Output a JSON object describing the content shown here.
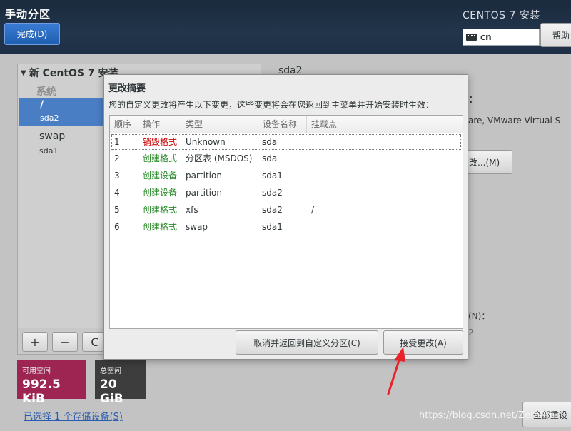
{
  "header": {
    "title": "手动分区",
    "done_button": "完成(D)",
    "product": "CENTOS 7 安装",
    "keyboard_layout": "cn",
    "help_button": "帮助"
  },
  "left_panel": {
    "install_title": "新 CentOS 7 安装",
    "system_label": "系统",
    "partitions": [
      {
        "mount": "/",
        "device": "sda2",
        "selected": true
      },
      {
        "mount": "swap",
        "device": "sda1",
        "selected": false
      }
    ],
    "tools": {
      "add": "+",
      "remove": "−",
      "refresh": "C"
    },
    "available_space": {
      "label": "可用空间",
      "value": "992.5 KiB"
    },
    "total_space": {
      "label": "总空间",
      "value": "20 GiB"
    },
    "storage_link": "已选择 1 个存储设备(S)"
  },
  "right_panel": {
    "title": "sda2",
    "colon_label": "：",
    "device_info": "are, VMware Virtual S",
    "modify_button": "改...(M)",
    "name_label": "(N)：",
    "name_value": "2",
    "reset_button": "全部重设"
  },
  "dialog": {
    "title": "更改摘要",
    "description": "您的自定义更改将产生以下变更，这些变更将会在您返回到主菜单并开始安装时生效：",
    "columns": [
      "顺序",
      "操作",
      "类型",
      "设备名称",
      "挂载点"
    ],
    "rows": [
      {
        "order": "1",
        "action": "销毁格式",
        "type": "Unknown",
        "device": "sda",
        "mount": "",
        "destructive": true
      },
      {
        "order": "2",
        "action": "创建格式",
        "type": "分区表 (MSDOS)",
        "device": "sda",
        "mount": "",
        "destructive": false
      },
      {
        "order": "3",
        "action": "创建设备",
        "type": "partition",
        "device": "sda1",
        "mount": "",
        "destructive": false
      },
      {
        "order": "4",
        "action": "创建设备",
        "type": "partition",
        "device": "sda2",
        "mount": "",
        "destructive": false
      },
      {
        "order": "5",
        "action": "创建格式",
        "type": "xfs",
        "device": "sda2",
        "mount": "/",
        "destructive": false
      },
      {
        "order": "6",
        "action": "创建格式",
        "type": "swap",
        "device": "sda1",
        "mount": "",
        "destructive": false
      }
    ],
    "cancel_button": "取消并返回到自定义分区(C)",
    "accept_button": "接受更改(A)"
  },
  "watermark": "https://blog.csdn.net/ZeroRm",
  "colors": {
    "header_bg": "#1e3045",
    "selection": "#4a7ec4",
    "available_space": "#9e2452",
    "destructive_action": "#cc0000",
    "create_action": "#2a8a2a",
    "annotation_arrow": "#e8232a"
  }
}
